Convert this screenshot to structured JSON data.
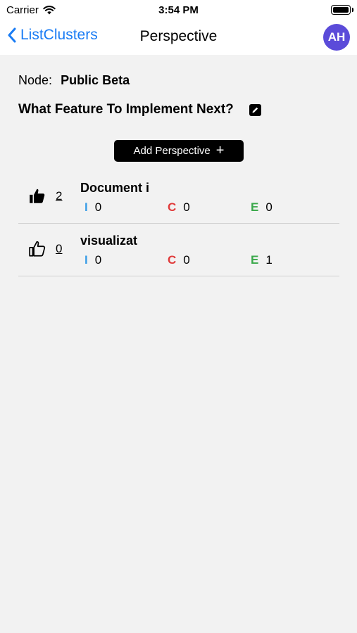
{
  "status_bar": {
    "carrier": "Carrier",
    "time": "3:54 PM"
  },
  "nav": {
    "back_label": "ListClusters",
    "title": "Perspective",
    "avatar_initials": "AH",
    "avatar_color": "#5b4bd9",
    "accent": "#1a7cf4"
  },
  "node": {
    "label": "Node:",
    "value": "Public Beta"
  },
  "question": {
    "text": "What Feature To Implement Next?"
  },
  "add_button": {
    "label": "Add Perspective",
    "icon": "plus-icon"
  },
  "colors": {
    "I": "#3a9de6",
    "C": "#e03a3a",
    "E": "#3aa84a"
  },
  "perspectives": [
    {
      "votes": "2",
      "liked": true,
      "thumb_icon": "thumb-up-filled-icon",
      "title": "Document i",
      "metrics": {
        "I_key": "I",
        "I": "0",
        "C_key": "C",
        "C": "0",
        "E_key": "E",
        "E": "0"
      }
    },
    {
      "votes": "0",
      "liked": false,
      "thumb_icon": "thumb-up-outline-icon",
      "title": "visualizat",
      "metrics": {
        "I_key": "I",
        "I": "0",
        "C_key": "C",
        "C": "0",
        "E_key": "E",
        "E": "1"
      }
    }
  ]
}
